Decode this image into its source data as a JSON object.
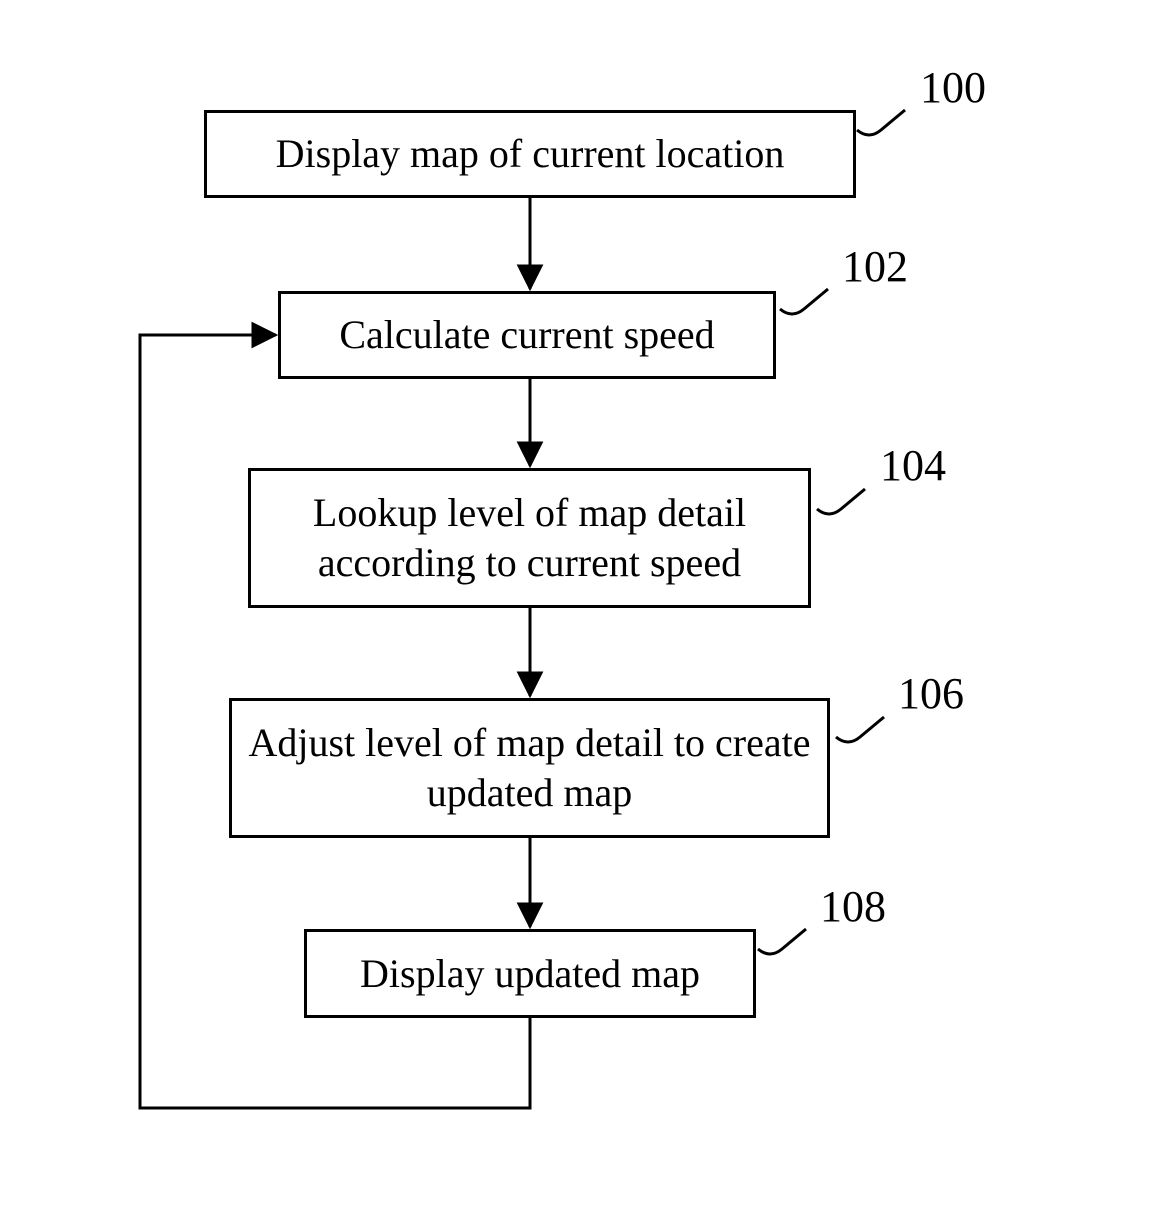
{
  "nodes": {
    "n100": {
      "text": "Display map of current location",
      "label": "100"
    },
    "n102": {
      "text": "Calculate current speed",
      "label": "102"
    },
    "n104": {
      "text": "Lookup level of map detail according to current speed",
      "label": "104"
    },
    "n106": {
      "text": "Adjust level of map detail to create updated map",
      "label": "106"
    },
    "n108": {
      "text": "Display updated map",
      "label": "108"
    }
  },
  "chart_data": {
    "type": "flowchart",
    "nodes": [
      {
        "id": "100",
        "text": "Display map of current location"
      },
      {
        "id": "102",
        "text": "Calculate current speed"
      },
      {
        "id": "104",
        "text": "Lookup level of map detail according to current speed"
      },
      {
        "id": "106",
        "text": "Adjust level of map detail to create updated map"
      },
      {
        "id": "108",
        "text": "Display updated map"
      }
    ],
    "edges": [
      {
        "from": "100",
        "to": "102"
      },
      {
        "from": "102",
        "to": "104"
      },
      {
        "from": "104",
        "to": "106"
      },
      {
        "from": "106",
        "to": "108"
      },
      {
        "from": "108",
        "to": "102"
      }
    ]
  }
}
